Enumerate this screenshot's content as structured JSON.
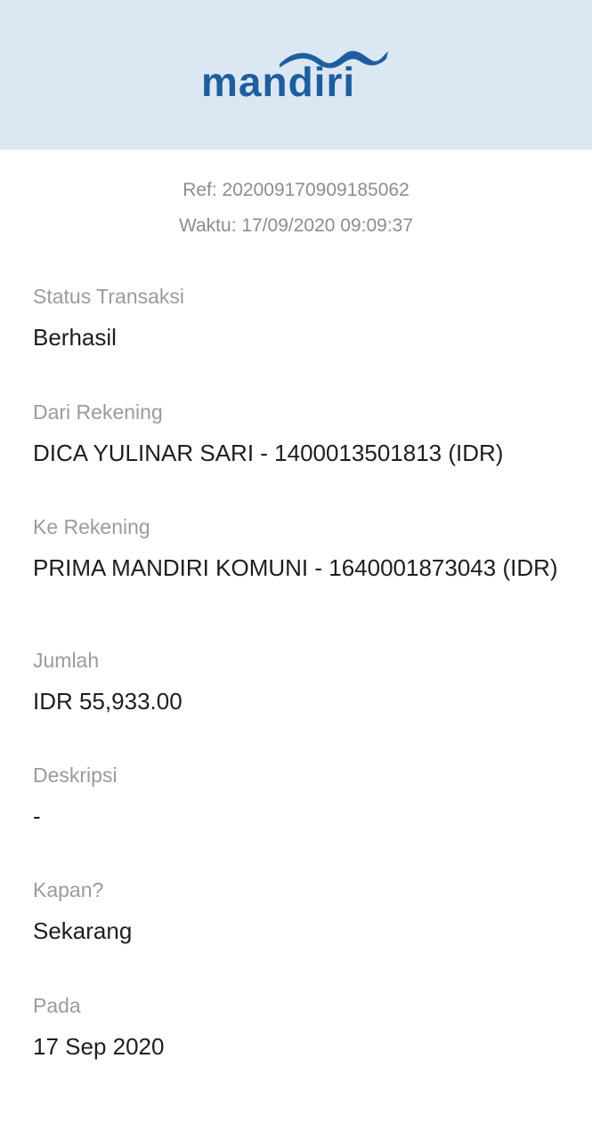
{
  "header": {
    "logo_text": "mandiri",
    "logo_icon": "mandiri-wave-logo",
    "background": "#dbe7f3",
    "logo_color": "#1f5e9e"
  },
  "meta": {
    "ref": "Ref: 202009170909185062",
    "time": "Waktu: 17/09/2020 09:09:37"
  },
  "fields": [
    {
      "label": "Status Transaksi",
      "value": "Berhasil"
    },
    {
      "label": "Dari Rekening",
      "value": "DICA YULINAR SARI - 1400013501813 (IDR)"
    },
    {
      "label": "Ke Rekening",
      "value": "PRIMA MANDIRI KOMUNI - 1640001873043 (IDR)"
    },
    {
      "label": "Jumlah",
      "value": "IDR 55,933.00"
    },
    {
      "label": "Deskripsi",
      "value": "-"
    },
    {
      "label": "Kapan?",
      "value": "Sekarang"
    },
    {
      "label": "Pada",
      "value": "17 Sep 2020"
    }
  ]
}
